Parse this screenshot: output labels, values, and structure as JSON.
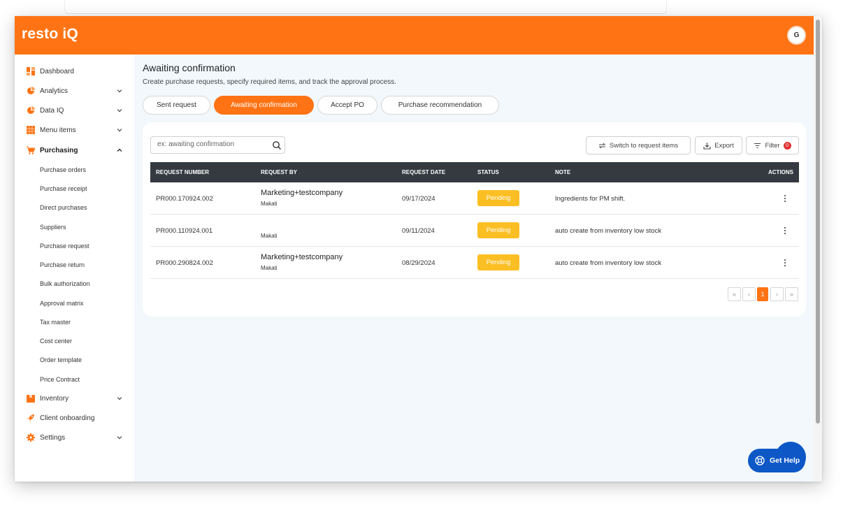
{
  "app": {
    "brand": "resto iQ",
    "avatar_initial": "G"
  },
  "sidebar": {
    "items": [
      {
        "label": "Dashboard",
        "icon": "dashboard-icon"
      },
      {
        "label": "Analytics",
        "icon": "pie-chart-icon"
      },
      {
        "label": "Data IQ",
        "icon": "pie-chart-icon"
      },
      {
        "label": "Menu items",
        "icon": "grid-icon"
      },
      {
        "label": "Purchasing",
        "icon": "cart-icon"
      },
      {
        "label": "Inventory",
        "icon": "box-icon"
      },
      {
        "label": "Client onboarding",
        "icon": "rocket-icon"
      },
      {
        "label": "Settings",
        "icon": "gear-icon"
      }
    ],
    "purchasing_sub": [
      "Purchase orders",
      "Purchase receipt",
      "Direct purchases",
      "Suppliers",
      "Purchase request",
      "Purchase return",
      "Bulk authorization",
      "Approval matrix",
      "Tax master",
      "Cost center",
      "Order template",
      "Price Contract"
    ]
  },
  "page": {
    "title": "Awaiting confirmation",
    "subtitle": "Create purchase requests, specify required items, and track the approval process."
  },
  "tabs": [
    "Sent request",
    "Awaiting confirmation",
    "Accept PO",
    "Purchase recommendation"
  ],
  "toolbar": {
    "search_placeholder": "ex: awaiting confirmation",
    "switch_label": "Switch to request items",
    "export_label": "Export",
    "filter_label": "Filter",
    "filter_count": "0"
  },
  "table": {
    "headers": [
      "REQUEST NUMBER",
      "REQUEST BY",
      "REQUEST DATE",
      "STATUS",
      "NOTE",
      "ACTIONS"
    ],
    "rows": [
      {
        "number": "PR000.170924.002",
        "by_name": "Marketing+testcompany",
        "by_location": "Makati",
        "date": "09/17/2024",
        "status": "Pending",
        "note": "Ingredients for PM shift."
      },
      {
        "number": "PR000.110924.001",
        "by_name": "",
        "by_location": "Makati",
        "date": "09/11/2024",
        "status": "Pending",
        "note": "auto create from inventory low stock"
      },
      {
        "number": "PR000.290824.002",
        "by_name": "Marketing+testcompany",
        "by_location": "Makati",
        "date": "08/29/2024",
        "status": "Pending",
        "note": "auto create from inventory low stock"
      }
    ]
  },
  "pagination": {
    "first": "«",
    "prev": "‹",
    "current": "1",
    "next": "›",
    "last": "»"
  },
  "help": {
    "label": "Get Help"
  },
  "colors": {
    "brand_orange": "#ff7314",
    "status_pending": "#fbbf24",
    "help_blue": "#0d58c6",
    "table_header": "#343a40"
  }
}
